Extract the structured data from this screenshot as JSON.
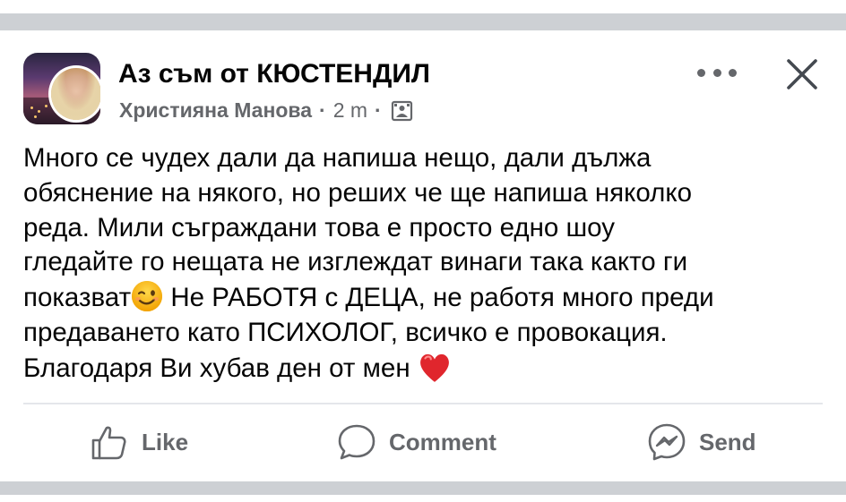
{
  "post": {
    "group_name": "Аз съм от КЮСТЕНДИЛ",
    "author": "Християна Манова",
    "separator": "·",
    "time": "2 m",
    "lines": [
      "Много се чудех дали да напиша нещо, дали дължа",
      "обяснение на някого, но реших че ще напиша няколко",
      "реда. Мили съграждани това е просто едно шоу",
      "гледайте го нещата не изглеждат винаги така както ги"
    ],
    "line5_a": "показват",
    "line5_b": " Не РАБОТЯ с ДЕЦА, не работя много преди",
    "line6": "предаването като ПСИХОЛОГ, всичко е провокация.",
    "line7": "Благодаря Ви хубав ден от мен ",
    "emojis": [
      "winking-face",
      "red-heart"
    ]
  },
  "actions": {
    "like_label": "Like",
    "comment_label": "Comment",
    "send_label": "Send"
  },
  "icons": [
    "more-icon",
    "close-icon",
    "privacy-icon",
    "like-icon",
    "comment-icon",
    "messenger-icon"
  ],
  "colors": {
    "text": "#050505",
    "secondary": "#65676b",
    "separator": "#cdd0d4",
    "heart": "#e0262d",
    "wink": "#f7b500"
  }
}
